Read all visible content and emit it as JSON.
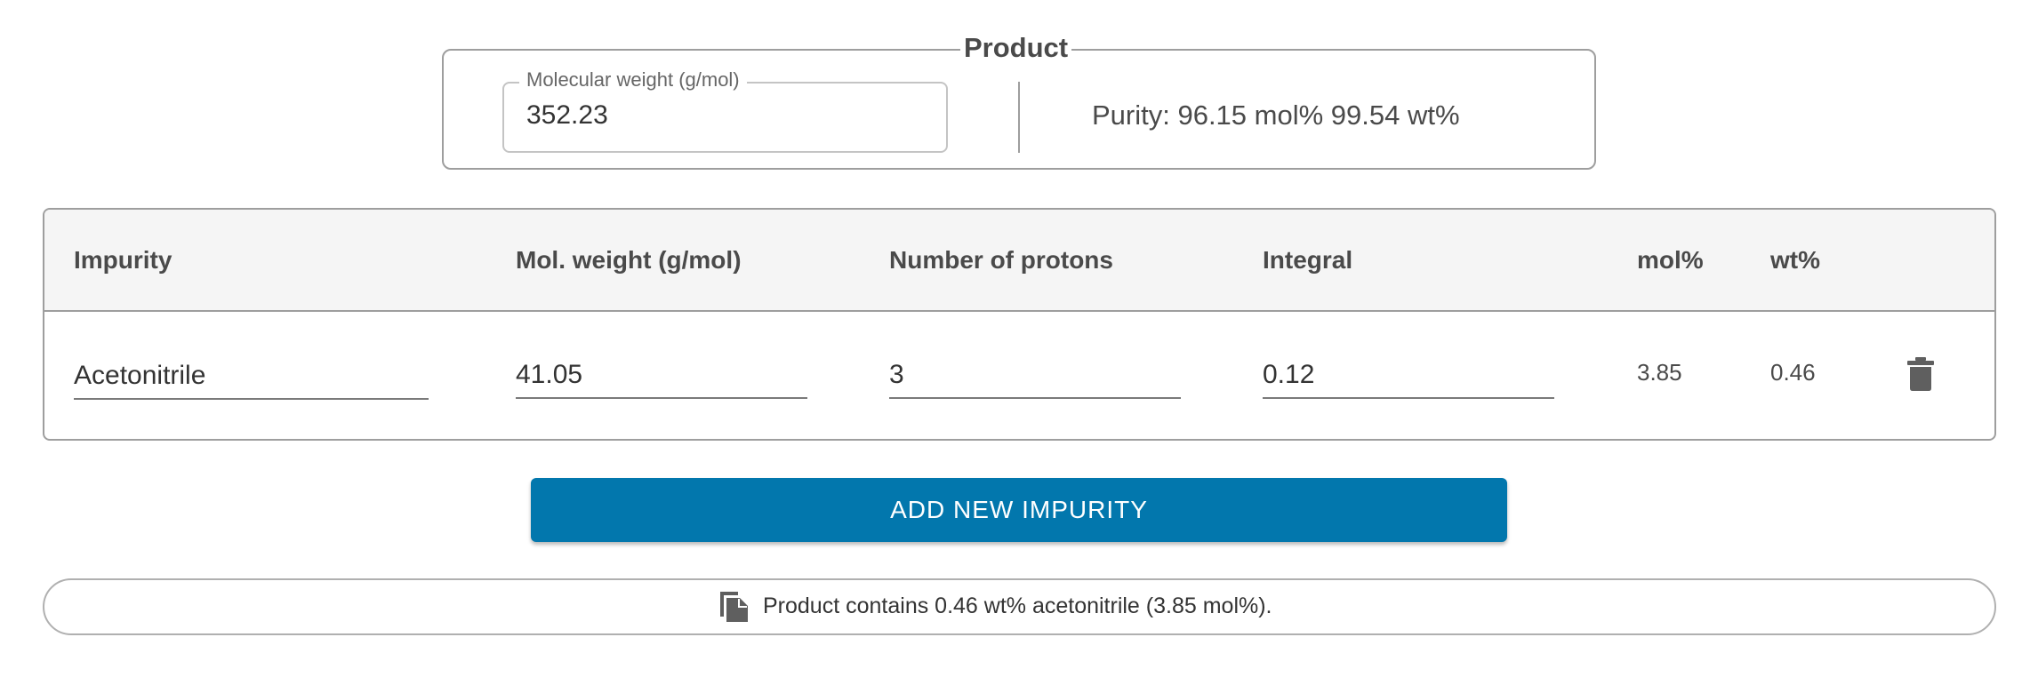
{
  "product": {
    "title": "Product",
    "molecular_weight_label": "Molecular weight (g/mol)",
    "molecular_weight_value": "352.23",
    "purity_text": "Purity: 96.15 mol% 99.54 wt%"
  },
  "table": {
    "headers": {
      "impurity": "Impurity",
      "mol_weight": "Mol. weight (g/mol)",
      "protons": "Number of protons",
      "integral": "Integral",
      "mol_pct": "mol%",
      "wt_pct": "wt%"
    },
    "rows": [
      {
        "impurity": "Acetonitrile",
        "mol_weight": "41.05",
        "protons": "3",
        "integral": "0.12",
        "mol_pct": "3.85",
        "wt_pct": "0.46",
        "delete_icon": "trash-icon"
      }
    ]
  },
  "add_button_label": "ADD NEW IMPURITY",
  "summary": {
    "icon": "copy-icon",
    "text": "Product contains 0.46 wt% acetonitrile (3.85 mol%)."
  },
  "colors": {
    "primary": "#0277ad",
    "border": "#9e9e9e",
    "header_bg": "#f5f5f5",
    "icon": "#5f5f5f"
  }
}
